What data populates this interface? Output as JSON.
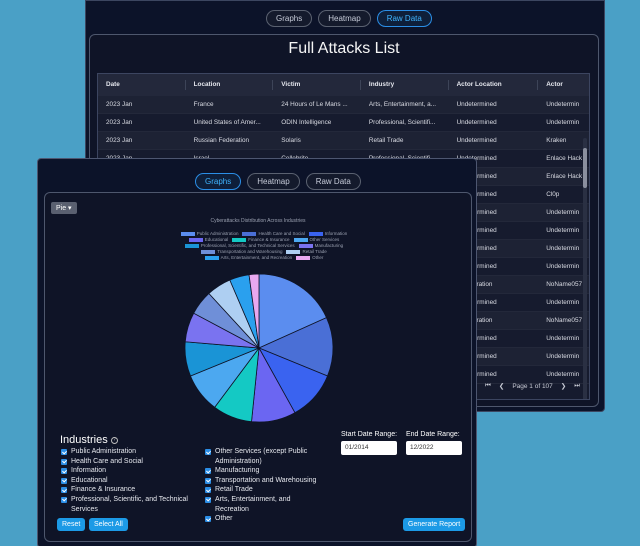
{
  "back": {
    "tabs": [
      "Graphs",
      "Heatmap",
      "Raw Data"
    ],
    "title": "Full Attacks List",
    "columns": [
      "Date",
      "Location",
      "Victim",
      "Industry",
      "Actor Location",
      "Actor"
    ],
    "rows": [
      [
        "2023 Jan",
        "France",
        "24 Hours of Le Mans ...",
        "Arts, Entertainment, a...",
        "Undetermined",
        "Undetermin"
      ],
      [
        "2023 Jan",
        "United States of Amer...",
        "ODIN Intelligence",
        "Professional, Scientifi...",
        "Undetermined",
        "Undetermin"
      ],
      [
        "2023 Jan",
        "Russian Federation",
        "Solaris",
        "Retail Trade",
        "Undetermined",
        "Kraken"
      ],
      [
        "2023 Jan",
        "Israel",
        "Cellebrite",
        "Professional, Scientifi...",
        "Undetermined",
        "Enlace Hack"
      ],
      [
        "",
        "",
        "",
        "",
        "Undetermined",
        "Enlace Hack"
      ],
      [
        "",
        "",
        "",
        "",
        "Undetermined",
        "Cl0p"
      ],
      [
        "",
        "",
        "",
        "",
        "Undetermined",
        "Undetermin"
      ],
      [
        "",
        "",
        "",
        "",
        "Undetermined",
        "Undetermin"
      ],
      [
        "",
        "",
        "",
        "",
        "Undetermined",
        "Undetermin"
      ],
      [
        "",
        "",
        "",
        "",
        "Undetermined",
        "Undetermin"
      ],
      [
        "",
        "",
        "",
        "",
        "n Federation",
        "NoName057"
      ],
      [
        "",
        "",
        "",
        "",
        "Undetermined",
        "Undetermin"
      ],
      [
        "",
        "",
        "",
        "",
        "n Federation",
        "NoName057"
      ],
      [
        "",
        "",
        "",
        "",
        "Undetermined",
        "Undetermin"
      ],
      [
        "",
        "",
        "",
        "",
        "Undetermined",
        "Undetermin"
      ],
      [
        "",
        "",
        "",
        "",
        "Undetermined",
        "Undetermin"
      ]
    ],
    "pager": {
      "first": "⏮",
      "prev": "❮",
      "text": "Page 1 of 107",
      "next": "❯",
      "last": "⏭"
    }
  },
  "front": {
    "tabs": [
      "Graphs",
      "Heatmap",
      "Raw Data"
    ],
    "chart_type_button": "Pie ▾",
    "chart_title": "Cyberattacks Distribution Across Industries",
    "industries_title": "Industries",
    "info_icon": "?",
    "industries_left": [
      "Public Administration",
      "Health Care and Social",
      "Information",
      "Educational",
      "Finance & Insurance",
      "Professional, Scientific, and Technical Services"
    ],
    "industries_right": [
      "Other Services (except Public Administration)",
      "Manufacturing",
      "Transportation and Warehousing",
      "Retail Trade",
      "Arts, Entertainment, and Recreation",
      "Other"
    ],
    "start_label": "Start Date Range:",
    "start_value": "01/2014",
    "end_label": "End Date Range:",
    "end_value": "12/2022",
    "reset_label": "Reset",
    "select_all_label": "Select All",
    "generate_label": "Generate Report"
  },
  "chart_data": {
    "type": "pie",
    "title": "Cyberattacks Distribution Across Industries",
    "legend_position": "top",
    "categories": [
      "Public Administration",
      "Health Care and Social",
      "Information",
      "Educational",
      "Finance & Insurance",
      "Other Services",
      "Professional, Scientific, and Technical Services",
      "Manufacturing",
      "Transportation and Warehousing",
      "Retail Trade",
      "Arts, Entertainment, and Recreation",
      "Other"
    ],
    "values": [
      17,
      12,
      10,
      9,
      8,
      8,
      7,
      6,
      5,
      5,
      4,
      2
    ],
    "colors": [
      "#5b8def",
      "#4a6fd6",
      "#3a63f0",
      "#6b66f2",
      "#14c9c4",
      "#4ca8f0",
      "#1a94d6",
      "#7a73f0",
      "#6f8fd8",
      "#aecff2",
      "#2aa0ee",
      "#e8a8f0"
    ]
  }
}
